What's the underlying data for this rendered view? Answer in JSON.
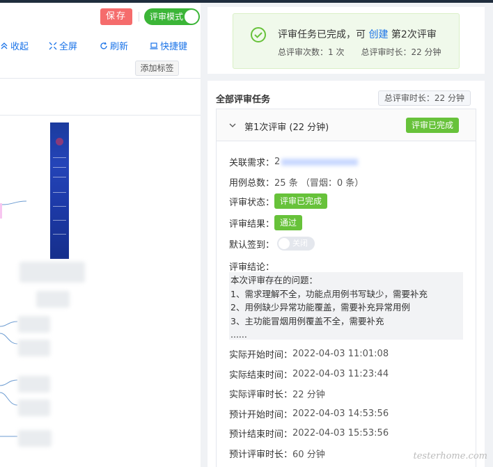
{
  "toolbar": {
    "save_label": "保存",
    "mode_label": "评审模式",
    "collapse_label": "收起",
    "fullscreen_label": "全屏",
    "refresh_label": "刷新",
    "shortcut_label": "快捷键",
    "add_tag_label": "添加标签"
  },
  "success": {
    "message_prefix": "评审任务已完成，可",
    "create_link": "创建",
    "message_suffix": "第2次评审",
    "stats": "总评审次数：1 次　　总评审时长：22 分钟"
  },
  "tasks": {
    "title": "全部评审任务",
    "total_duration": "总评审时长：22 分钟",
    "card": {
      "title": "第1次评审 (22 分钟)",
      "status_badge": "评审已完成",
      "fields": {
        "related_req_label": "关联需求：",
        "related_req_value": "2",
        "case_total_label": "用例总数：",
        "case_total_value": "25 条 （冒烟：0 条）",
        "status_label": "评审状态：",
        "status_value": "评审已完成",
        "result_label": "评审结果：",
        "result_value": "通过",
        "signin_label": "默认签到：",
        "signin_value": "关闭",
        "conclusion_label": "评审结论：",
        "conclusion_lines": [
          "本次评审存在的问题：",
          "1、需求理解不全，功能点用例书写缺少，需要补充",
          "2、用例缺少异常功能覆盖，需要补充异常用例",
          "3、主功能冒烟用例覆盖不全，需要补充",
          "......"
        ],
        "actual_start_label": "实际开始时间：",
        "actual_start_value": "2022-04-03 11:01:08",
        "actual_end_label": "实际结束时间：",
        "actual_end_value": "2022-04-03 11:23:44",
        "actual_duration_label": "实际评审时长：",
        "actual_duration_value": "22 分钟",
        "plan_start_label": "预计开始时间：",
        "plan_start_value": "2022-04-03 14:53:56",
        "plan_end_label": "预计结束时间：",
        "plan_end_value": "2022-04-03 15:53:56",
        "plan_duration_label": "预计评审时长：",
        "plan_duration_value": "60 分钟"
      }
    }
  },
  "watermark": "testerhome.com",
  "colors": {
    "accent": "#1a73e8",
    "success": "#67c23a",
    "danger": "#f56c6c",
    "toggle_on": "#3bb537"
  }
}
